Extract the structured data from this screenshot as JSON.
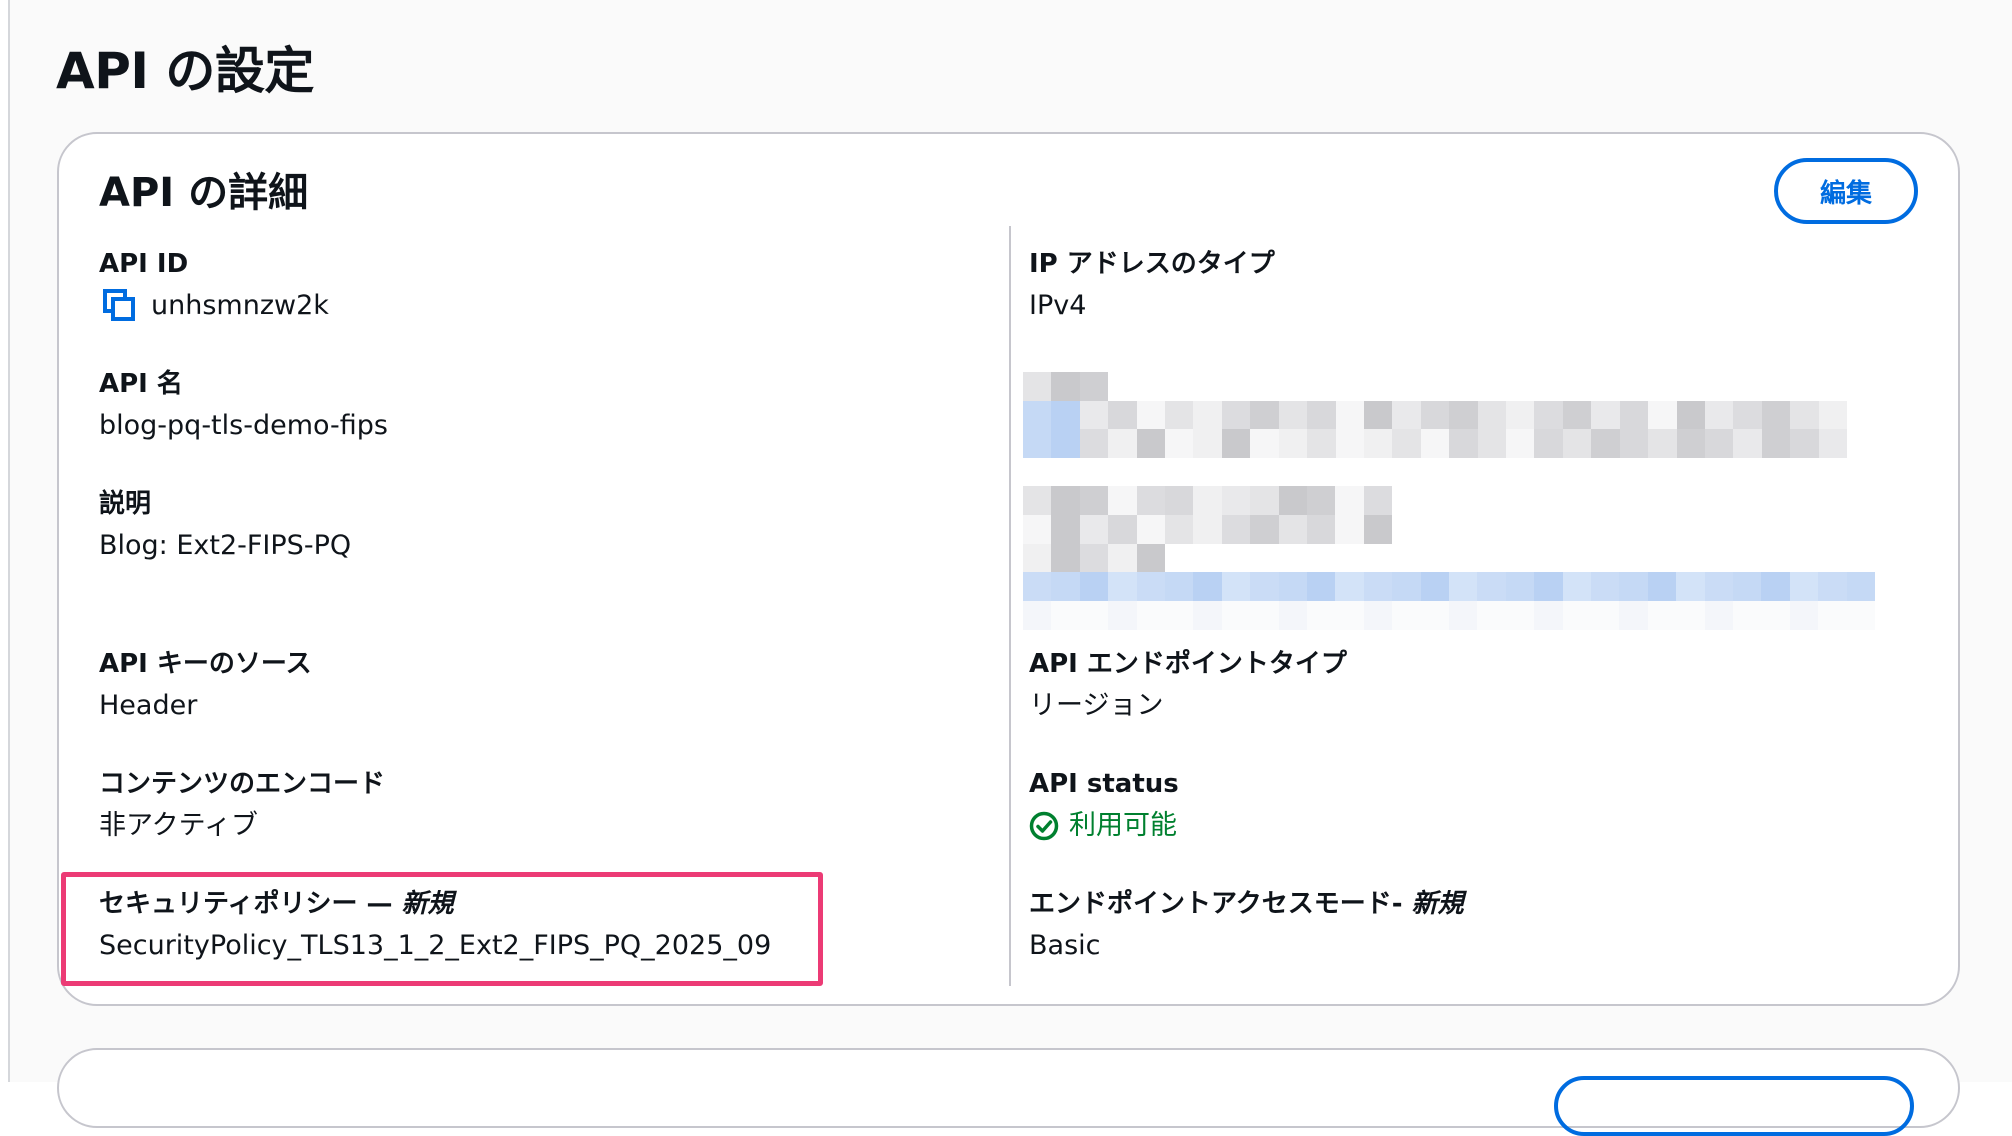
{
  "page": {
    "title": "API の設定"
  },
  "card": {
    "title": "API の詳細",
    "edit_label": "編集"
  },
  "left_fields": {
    "api_id": {
      "label": "API ID",
      "value": "unhsmnzw2k",
      "icon": "copy-icon"
    },
    "api_name": {
      "label": "API 名",
      "value": "blog-pq-tls-demo-fips"
    },
    "description": {
      "label": "説明",
      "value": "Blog: Ext2-FIPS-PQ"
    },
    "api_key_source": {
      "label": "API キーのソース",
      "value": "Header"
    },
    "content_encoding": {
      "label": "コンテンツのエンコード",
      "value": "非アクティブ"
    },
    "security_policy": {
      "label": "セキュリティポリシー —",
      "new_tag": "新規",
      "value": "SecurityPolicy_TLS13_1_2_Ext2_FIPS_PQ_2025_09"
    }
  },
  "right_fields": {
    "ip_address_type": {
      "label": "IP アドレスのタイプ",
      "value": "IPv4"
    },
    "endpoint_type": {
      "label": "API エンドポイントタイプ",
      "value": "リージョン"
    },
    "api_status": {
      "label": "API status",
      "value": "利用可能",
      "icon": "check-circle-icon"
    },
    "endpoint_access_mode": {
      "label": "エンドポイントアクセスモード-",
      "new_tag": "新規",
      "value": "Basic"
    }
  },
  "colors": {
    "accent": "#006ce0",
    "success": "#00802f",
    "highlight": "#ec3b75",
    "border": "#c6c6cd"
  }
}
